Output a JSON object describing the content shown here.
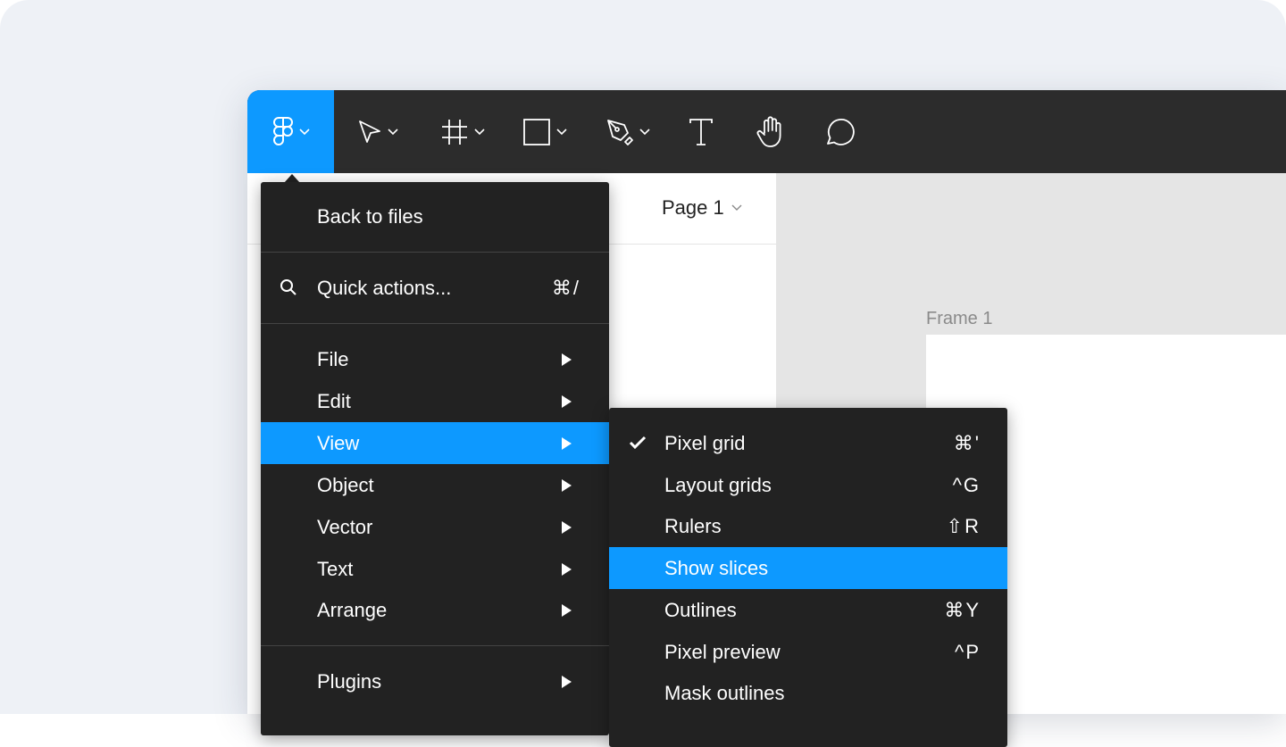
{
  "toolbar": {
    "main_menu_icon": "figma-logo-icon",
    "tools": [
      {
        "name": "move-tool",
        "icon": "cursor-arrow-icon"
      },
      {
        "name": "frame-tool",
        "icon": "frame-hash-icon"
      },
      {
        "name": "shape-tool",
        "icon": "rectangle-icon"
      },
      {
        "name": "pen-tool",
        "icon": "pen-icon"
      },
      {
        "name": "text-tool",
        "icon": "text-T-icon"
      },
      {
        "name": "hand-tool",
        "icon": "hand-icon"
      },
      {
        "name": "comment-tool",
        "icon": "comment-bubble-icon"
      }
    ]
  },
  "page": {
    "name": "Page 1"
  },
  "canvas": {
    "frame_label": "Frame 1"
  },
  "main_menu": {
    "back": "Back to files",
    "quick_actions": {
      "label": "Quick actions...",
      "shortcut": "⌘/"
    },
    "items": [
      {
        "label": "File"
      },
      {
        "label": "Edit"
      },
      {
        "label": "View",
        "active": true
      },
      {
        "label": "Object"
      },
      {
        "label": "Vector"
      },
      {
        "label": "Text"
      },
      {
        "label": "Arrange"
      }
    ],
    "plugins": "Plugins"
  },
  "view_submenu": {
    "items": [
      {
        "label": "Pixel grid",
        "shortcut": "⌘'",
        "checked": true
      },
      {
        "label": "Layout grids",
        "shortcut": "^G"
      },
      {
        "label": "Rulers",
        "shortcut": "⇧R"
      },
      {
        "label": "Show slices",
        "shortcut": "",
        "active": true
      },
      {
        "label": "Outlines",
        "shortcut": "⌘Y"
      },
      {
        "label": "Pixel preview",
        "shortcut": "^P"
      },
      {
        "label": "Mask outlines",
        "shortcut": ""
      }
    ]
  },
  "colors": {
    "accent": "#0d99ff",
    "toolbar": "#2c2c2c",
    "menu": "#222222",
    "canvas": "#e5e5e5"
  }
}
